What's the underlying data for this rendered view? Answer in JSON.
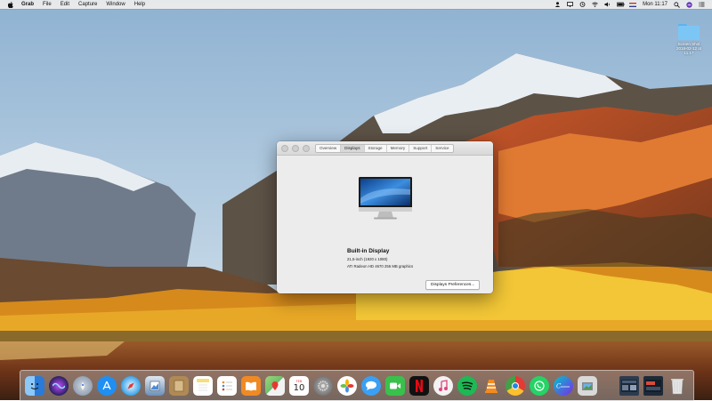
{
  "menubar": {
    "app_name": "Grab",
    "items": [
      "File",
      "Edit",
      "Capture",
      "Window",
      "Help"
    ],
    "clock": "Mon 11:17"
  },
  "desktop": {
    "folder_label": "Screen Shot 2018-02-12 at 11.17"
  },
  "about_window": {
    "tabs": [
      "Overview",
      "Displays",
      "Storage",
      "Memory",
      "Support",
      "Service"
    ],
    "active_tab": "Displays",
    "display_name": "Built-in Display",
    "resolution": "21,5-inch (1920 x 1080)",
    "graphics": "ATI Radeon HD 4670 256 MB graphics",
    "prefs_button": "Displays Preferences..."
  },
  "dock": {
    "calendar_day": "10",
    "calendar_month": "FEB",
    "apps": [
      {
        "name": "Finder",
        "icon": "finder-icon",
        "color": "#3b8fe6"
      },
      {
        "name": "Siri",
        "icon": "siri-icon",
        "color": "#3a2a6e"
      },
      {
        "name": "Launchpad",
        "icon": "launchpad-icon",
        "color": "#7a8a9e"
      },
      {
        "name": "App Store",
        "icon": "app-store-icon",
        "color": "#1f8ff3"
      },
      {
        "name": "Safari",
        "icon": "safari-icon",
        "color": "#2c9ee8"
      },
      {
        "name": "Preview",
        "icon": "preview-icon",
        "color": "#6b8fb8"
      },
      {
        "name": "Notefile",
        "icon": "notefile-icon",
        "color": "#b08a54"
      },
      {
        "name": "Notes",
        "icon": "notes-icon",
        "color": "#f5e07a"
      },
      {
        "name": "Reminders",
        "icon": "reminders-icon",
        "color": "#f3f3f3"
      },
      {
        "name": "iBooks",
        "icon": "ibooks-icon",
        "color": "#f08a24"
      },
      {
        "name": "Maps",
        "icon": "maps-icon",
        "color": "#6cbf6a"
      },
      {
        "name": "Calendar",
        "icon": "calendar-icon",
        "color": "#ffffff"
      },
      {
        "name": "System Preferences",
        "icon": "system-preferences-icon",
        "color": "#7d7d7d"
      },
      {
        "name": "Photos",
        "icon": "photos-icon",
        "color": "#ffffff"
      },
      {
        "name": "Messages",
        "icon": "messages-icon",
        "color": "#3ba0f3"
      },
      {
        "name": "FaceTime",
        "icon": "facetime-icon",
        "color": "#39c14b"
      },
      {
        "name": "Netflix",
        "icon": "netflix-icon",
        "color": "#111111"
      },
      {
        "name": "iTunes",
        "icon": "itunes-icon",
        "color": "#f2f2f2"
      },
      {
        "name": "Spotify",
        "icon": "spotify-icon",
        "color": "#1db954"
      },
      {
        "name": "VLC",
        "icon": "vlc-icon",
        "color": "#f7f7f7"
      },
      {
        "name": "Chrome",
        "icon": "chrome-icon",
        "color": "#f2f2f2"
      },
      {
        "name": "WhatsApp",
        "icon": "whatsapp-icon",
        "color": "#25d366"
      },
      {
        "name": "Canva",
        "icon": "canva-icon",
        "color": "#7d2ae8"
      },
      {
        "name": "Image Capture",
        "icon": "image-capture-icon",
        "color": "#d9d9d9"
      },
      {
        "name": "Desktop Stack",
        "icon": "desktop-stack-icon",
        "color": "#2d3b4e"
      },
      {
        "name": "Downloads Stack",
        "icon": "downloads-stack-icon",
        "color": "#1e2a38"
      },
      {
        "name": "Trash",
        "icon": "trash-icon",
        "color": "#e6e6e6"
      }
    ]
  }
}
